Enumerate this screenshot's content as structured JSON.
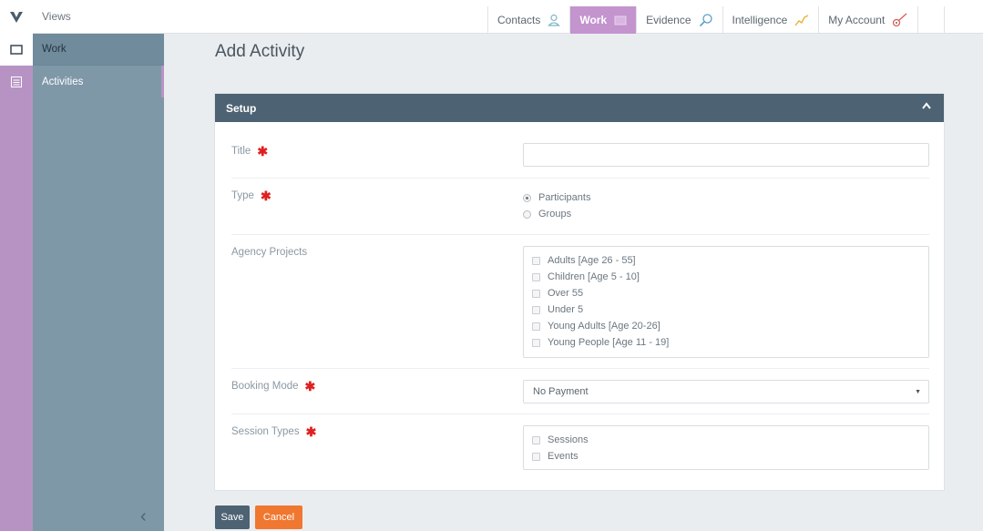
{
  "app": {
    "logo_letter": "V"
  },
  "sidebar": {
    "views_label": "Views",
    "items": [
      {
        "label": "Work",
        "icon": "folder-icon"
      },
      {
        "label": "Activities",
        "icon": "list-icon"
      }
    ],
    "collapse_glyph": "‹"
  },
  "topnav": {
    "tabs": [
      {
        "label": "Contacts",
        "icon": "person-icon"
      },
      {
        "label": "Work",
        "icon": "folder-icon",
        "active": true
      },
      {
        "label": "Evidence",
        "icon": "magnifier-icon"
      },
      {
        "label": "Intelligence",
        "icon": "trend-line-icon"
      },
      {
        "label": "My Account",
        "icon": "settings-key-icon"
      }
    ]
  },
  "page": {
    "title": "Add Activity"
  },
  "panel": {
    "heading": "Setup",
    "fields": {
      "title": {
        "label": "Title",
        "value": ""
      },
      "type": {
        "label": "Type",
        "options": [
          "Participants",
          "Groups"
        ],
        "selected": "Participants"
      },
      "projects": {
        "label": "Agency Projects",
        "options": [
          "Adults [Age 26 - 55]",
          "Children [Age 5 - 10]",
          "Over 55",
          "Under 5",
          "Young Adults [Age 20-26]",
          "Young People [Age 11 - 19]"
        ]
      },
      "booking": {
        "label": "Booking Mode",
        "value": "No Payment"
      },
      "sessions": {
        "label": "Session Types",
        "options": [
          "Sessions",
          "Events"
        ]
      }
    },
    "required_mark": "✱"
  },
  "actions": {
    "save": "Save",
    "cancel": "Cancel"
  },
  "colors": {
    "accent_purple": "#c394ce",
    "header_slate": "#4d6272",
    "cancel_orange": "#f0772f",
    "required_red": "#e02020"
  }
}
